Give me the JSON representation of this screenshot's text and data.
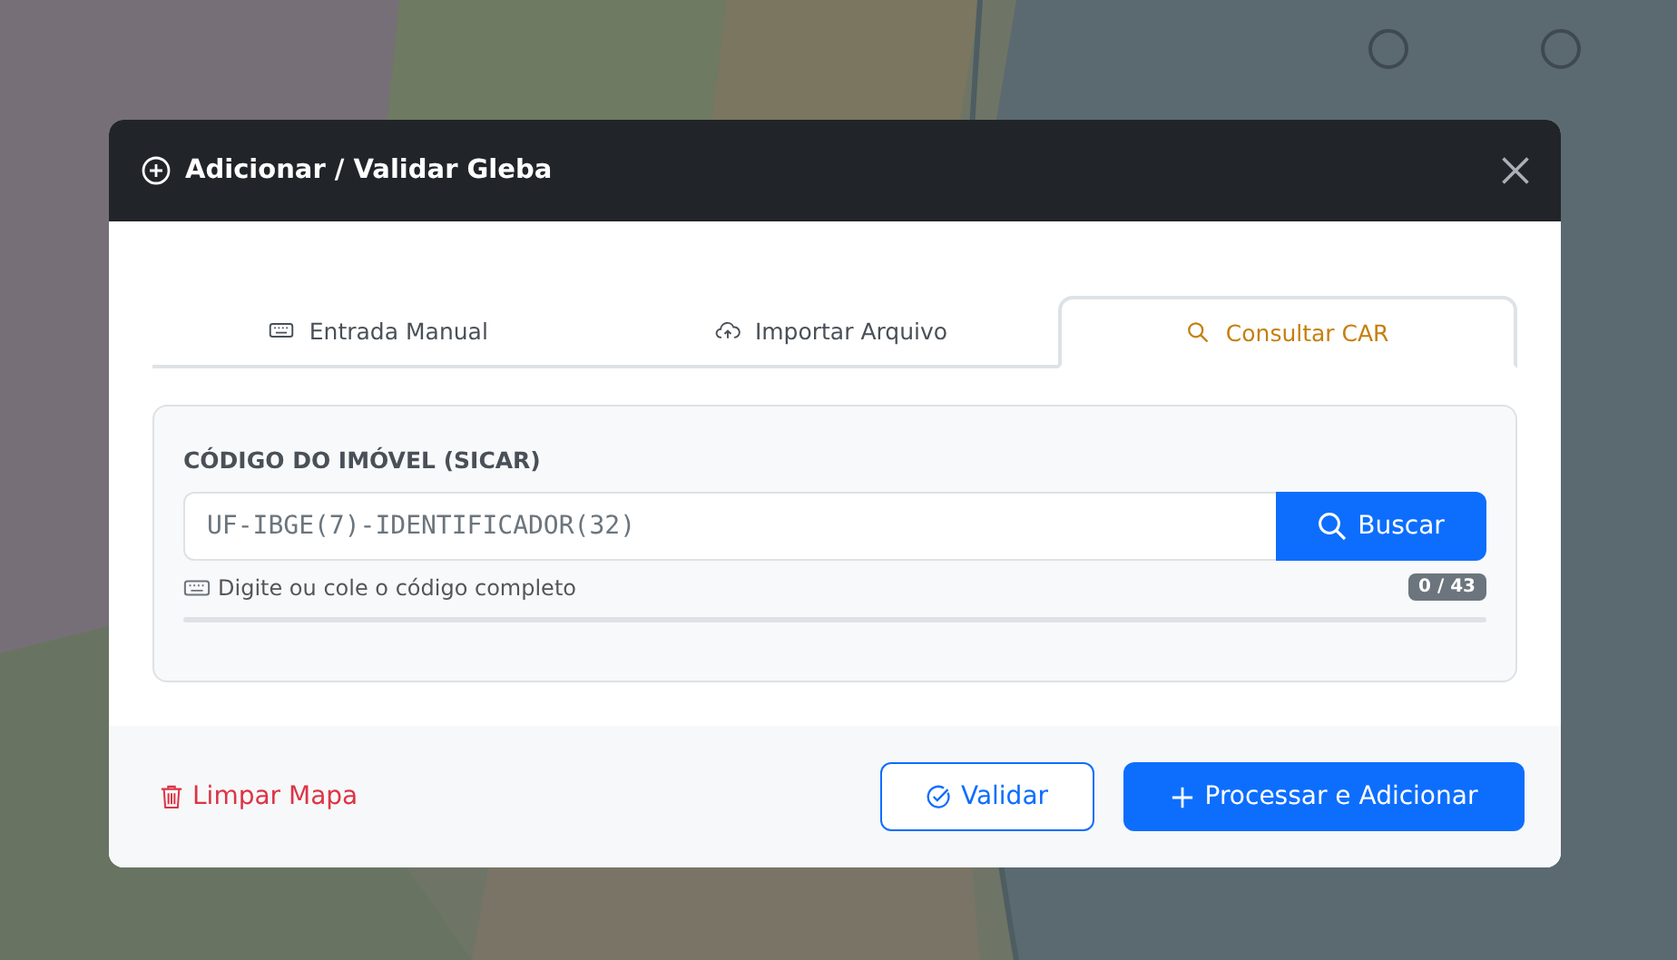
{
  "dialog": {
    "title": "Adicionar / Validar Gleba"
  },
  "tabs": [
    {
      "label": "Entrada Manual",
      "selected": false
    },
    {
      "label": "Importar Arquivo",
      "selected": false
    },
    {
      "label": "Consultar CAR",
      "selected": true
    }
  ],
  "car_query": {
    "label": "CÓDIGO DO IMÓVEL (SICAR)",
    "placeholder": "UF-IBGE(7)-IDENTIFICADOR(32)",
    "search_button": "Buscar",
    "hint": "Digite ou cole o código completo",
    "counter": "0 / 43",
    "progress": {
      "level": 0
    }
  },
  "footer": {
    "clear_link": "Limpar Mapa",
    "validate_button": "Validar",
    "submit_button": "Processar e Adicionar"
  }
}
